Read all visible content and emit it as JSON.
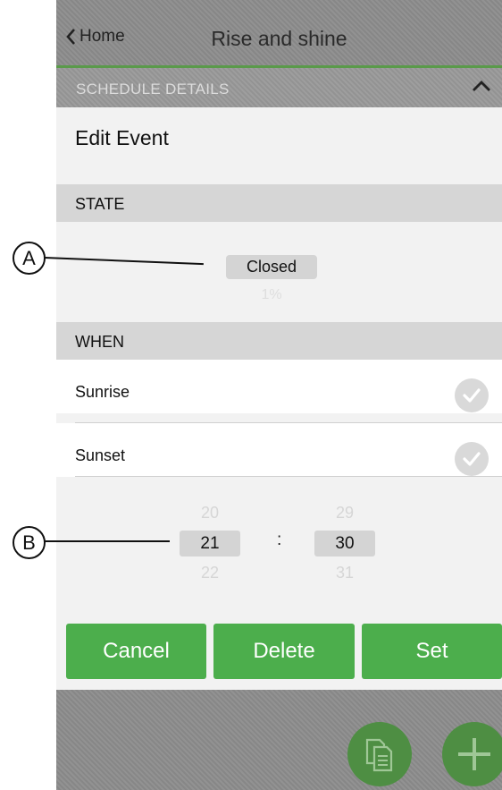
{
  "nav": {
    "back_label": "Home",
    "title": "Rise and shine"
  },
  "schedule_bar": {
    "label": "SCHEDULE DETAILS"
  },
  "edit": {
    "title": "Edit Event"
  },
  "state": {
    "header": "STATE",
    "value": "Closed",
    "percent": "1%"
  },
  "when": {
    "header": "WHEN",
    "options": [
      {
        "label": "Sunrise"
      },
      {
        "label": "Sunset"
      }
    ]
  },
  "time_picker": {
    "hours": {
      "prev": "20",
      "selected": "21",
      "next": "22"
    },
    "separator": ":",
    "minutes": {
      "prev": "29",
      "selected": "30",
      "next": "31"
    }
  },
  "buttons": {
    "cancel": "Cancel",
    "delete": "Delete",
    "set": "Set"
  },
  "callouts": {
    "a": "A",
    "b": "B"
  },
  "colors": {
    "accent_green": "#4cae4c",
    "fab_green": "#4e8e43",
    "header_gray": "#d6d6d6"
  },
  "icons": [
    "chevron-left-icon",
    "chevron-up-icon",
    "check-icon",
    "copy-icon",
    "plus-icon"
  ]
}
